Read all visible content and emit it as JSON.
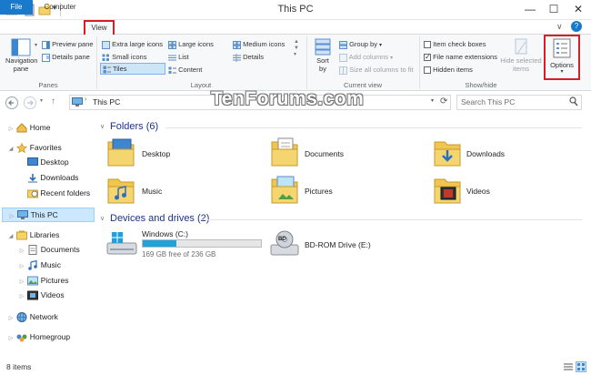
{
  "window": {
    "title": "This PC",
    "minimize": "—",
    "maximize": "☐",
    "close": "✕",
    "help": "?"
  },
  "tabs": [
    {
      "label": "File"
    },
    {
      "label": "Computer"
    },
    {
      "label": "View"
    }
  ],
  "ribbon": {
    "panes": {
      "navigation_pane": "Navigation\npane",
      "navigation_pane_l1": "Navigation",
      "navigation_pane_l2": "pane",
      "preview_pane": "Preview pane",
      "details_pane": "Details pane",
      "group_label": "Panes"
    },
    "layout": {
      "extra_large_icons": "Extra large icons",
      "large_icons": "Large icons",
      "medium_icons": "Medium icons",
      "small_icons": "Small icons",
      "list": "List",
      "details": "Details",
      "tiles": "Tiles",
      "content": "Content",
      "group_label": "Layout"
    },
    "current_view": {
      "sort_by_l1": "Sort",
      "sort_by_l2": "by",
      "group_by": "Group by",
      "add_columns": "Add columns",
      "size_all_columns": "Size all columns to fit",
      "group_label": "Current view"
    },
    "show_hide": {
      "item_check_boxes": "Item check boxes",
      "item_check_boxes_checked": false,
      "file_name_extensions": "File name extensions",
      "file_name_extensions_checked": true,
      "hidden_items": "Hidden items",
      "hidden_items_checked": false,
      "hide_selected_l1": "Hide selected",
      "hide_selected_l2": "items",
      "group_label": "Show/hide"
    },
    "options": {
      "label": "Options"
    }
  },
  "address": {
    "path": "This PC",
    "search_placeholder": "Search This PC"
  },
  "nav": {
    "home": "Home",
    "favorites": "Favorites",
    "desktop": "Desktop",
    "downloads": "Downloads",
    "recent_folders": "Recent folders",
    "this_pc": "This PC",
    "libraries": "Libraries",
    "documents": "Documents",
    "music": "Music",
    "pictures": "Pictures",
    "videos": "Videos",
    "network": "Network",
    "homegroup": "Homegroup"
  },
  "content": {
    "folders_header": "Folders (6)",
    "folders": [
      {
        "name": "Desktop"
      },
      {
        "name": "Documents"
      },
      {
        "name": "Downloads"
      },
      {
        "name": "Music"
      },
      {
        "name": "Pictures"
      },
      {
        "name": "Videos"
      }
    ],
    "devices_header": "Devices and drives (2)",
    "drives": [
      {
        "name": "Windows (C:)",
        "free_text": "169 GB free of 236 GB",
        "used_fraction": 0.284
      },
      {
        "name": "BD-ROM Drive (E:)"
      }
    ]
  },
  "watermark": "TenForums.com",
  "status": {
    "item_count": "8 items"
  },
  "colors": {
    "accent": "#1979ca",
    "highlight_box": "#d41f26",
    "selected_bg": "#cce8ff",
    "section_header": "#1e3287",
    "drive_bar": "#26a0da"
  }
}
